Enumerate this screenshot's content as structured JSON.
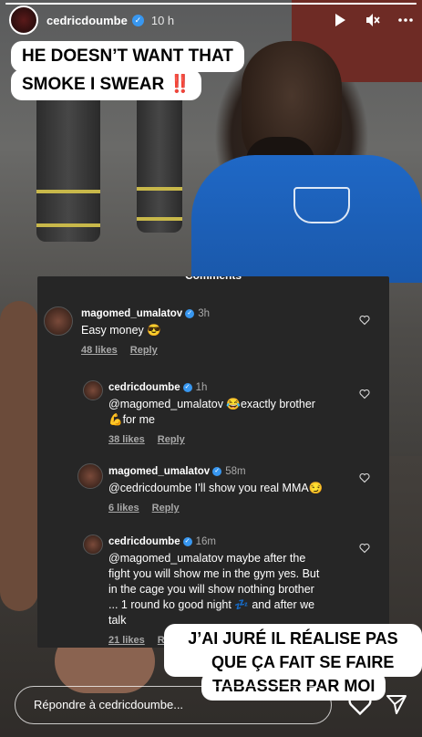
{
  "header": {
    "username": "cedricdoumbe",
    "verified_mark": "✓",
    "time": "10 h",
    "icons": [
      "play-icon",
      "mute-icon",
      "more-icon"
    ],
    "progress": 1.0
  },
  "captions": {
    "top_line1": "HE DOESN’T WANT THAT",
    "top_line2": "SMOKE I SWEAR ‼️",
    "bottom_line1": "J’AI JURÉ IL RÉALISE PAS CE",
    "bottom_line2": "QUE ÇA FAIT SE FAIRE",
    "bottom_line3": "TABASSER PAR MOI"
  },
  "panel": {
    "title": "Comments",
    "comments": [
      {
        "user": "magomed_umalatov",
        "time": "3h",
        "text": "Easy money 😎",
        "likes": "48 likes",
        "reply": "Reply"
      },
      {
        "user": "cedricdoumbe",
        "time": "1h",
        "text_line1": "@magomed_umalatov 😂exactly brother",
        "text_line2": "💪for me",
        "likes": "38 likes",
        "reply": "Reply"
      },
      {
        "user": "magomed_umalatov",
        "time": "58m",
        "text": "@cedricdoumbe I’ll show you real MMA😏",
        "likes": "6 likes",
        "reply": "Reply"
      },
      {
        "user": "cedricdoumbe",
        "time": "16m",
        "text_line1": "@magomed_umalatov maybe after the",
        "text_line2": "fight you will show me in the gym yes. But",
        "text_line3": "in the cage you will show nothing brother",
        "text_line4": "... 1 round ko good night 💤 and after we",
        "text_line5": "talk",
        "likes": "21 likes",
        "reply": "Reply"
      }
    ]
  },
  "reply_bar": {
    "placeholder": "Répondre à cedricdoumbe..."
  },
  "colors": {
    "panel_bg": "#262626",
    "verified": "#3897f0",
    "shirt": "#1f68c6"
  }
}
